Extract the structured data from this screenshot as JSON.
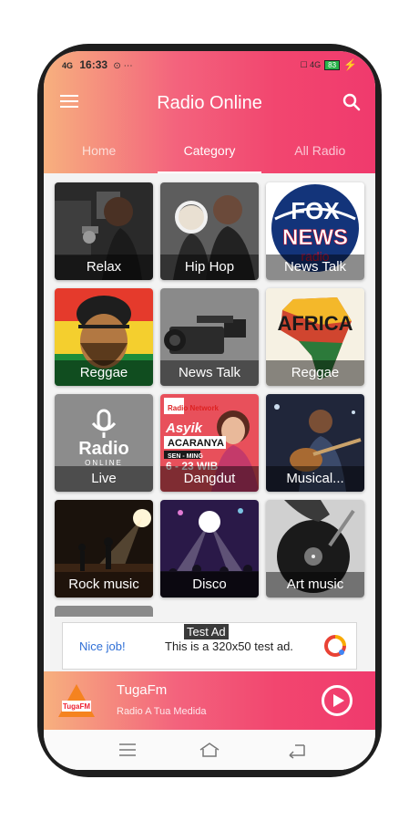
{
  "status_bar": {
    "signal": "4G",
    "time": "16:33",
    "extra_icons": "⊙ ⋯",
    "right_icons": "☐ 4G",
    "battery": "83"
  },
  "app": {
    "title": "Radio Online",
    "tabs": [
      "Home",
      "Category",
      "All Radio"
    ],
    "active_tab": "Category"
  },
  "categories": [
    {
      "label": "Relax",
      "art": "studio-woman-mic"
    },
    {
      "label": "Hip Hop",
      "art": "hiphop-duo"
    },
    {
      "label": "News Talk",
      "art": "fox-news-logo"
    },
    {
      "label": "Reggae",
      "art": "rasta-portrait"
    },
    {
      "label": "News Talk",
      "art": "video-camera"
    },
    {
      "label": "Reggae",
      "art": "africa-map"
    },
    {
      "label": "Live",
      "art": "radio-online-logo"
    },
    {
      "label": "Dangdut",
      "art": "asyik-acaranya-poster"
    },
    {
      "label": "Musical...",
      "art": "guitar-player"
    },
    {
      "label": "Rock music",
      "art": "rock-stage"
    },
    {
      "label": "Disco",
      "art": "disco-crowd"
    },
    {
      "label": "Art music",
      "art": "turntable"
    }
  ],
  "art_text": {
    "fox": "FOX",
    "news": "NEWS",
    "radio": "radio",
    "africa": "AFRICA",
    "radio_logo": "Radio",
    "online_logo": "ONLINE",
    "network": "Radio Network",
    "asyik": "Asyik",
    "acaranya": "ACARANYA",
    "schedule": "SEN - MING",
    "time": "6 - 23 WIB"
  },
  "ad": {
    "badge": "Test Ad",
    "headline": "Nice job!",
    "text": "This is a 320x50 test ad."
  },
  "player": {
    "title": "TugaFm",
    "subtitle": "Radio A Tua Medida",
    "thumb_text": "TugaFM"
  },
  "colors": {
    "gradient_start": "#f7b07e",
    "gradient_end": "#f03a6d",
    "ad_link": "#2f6fd6"
  }
}
